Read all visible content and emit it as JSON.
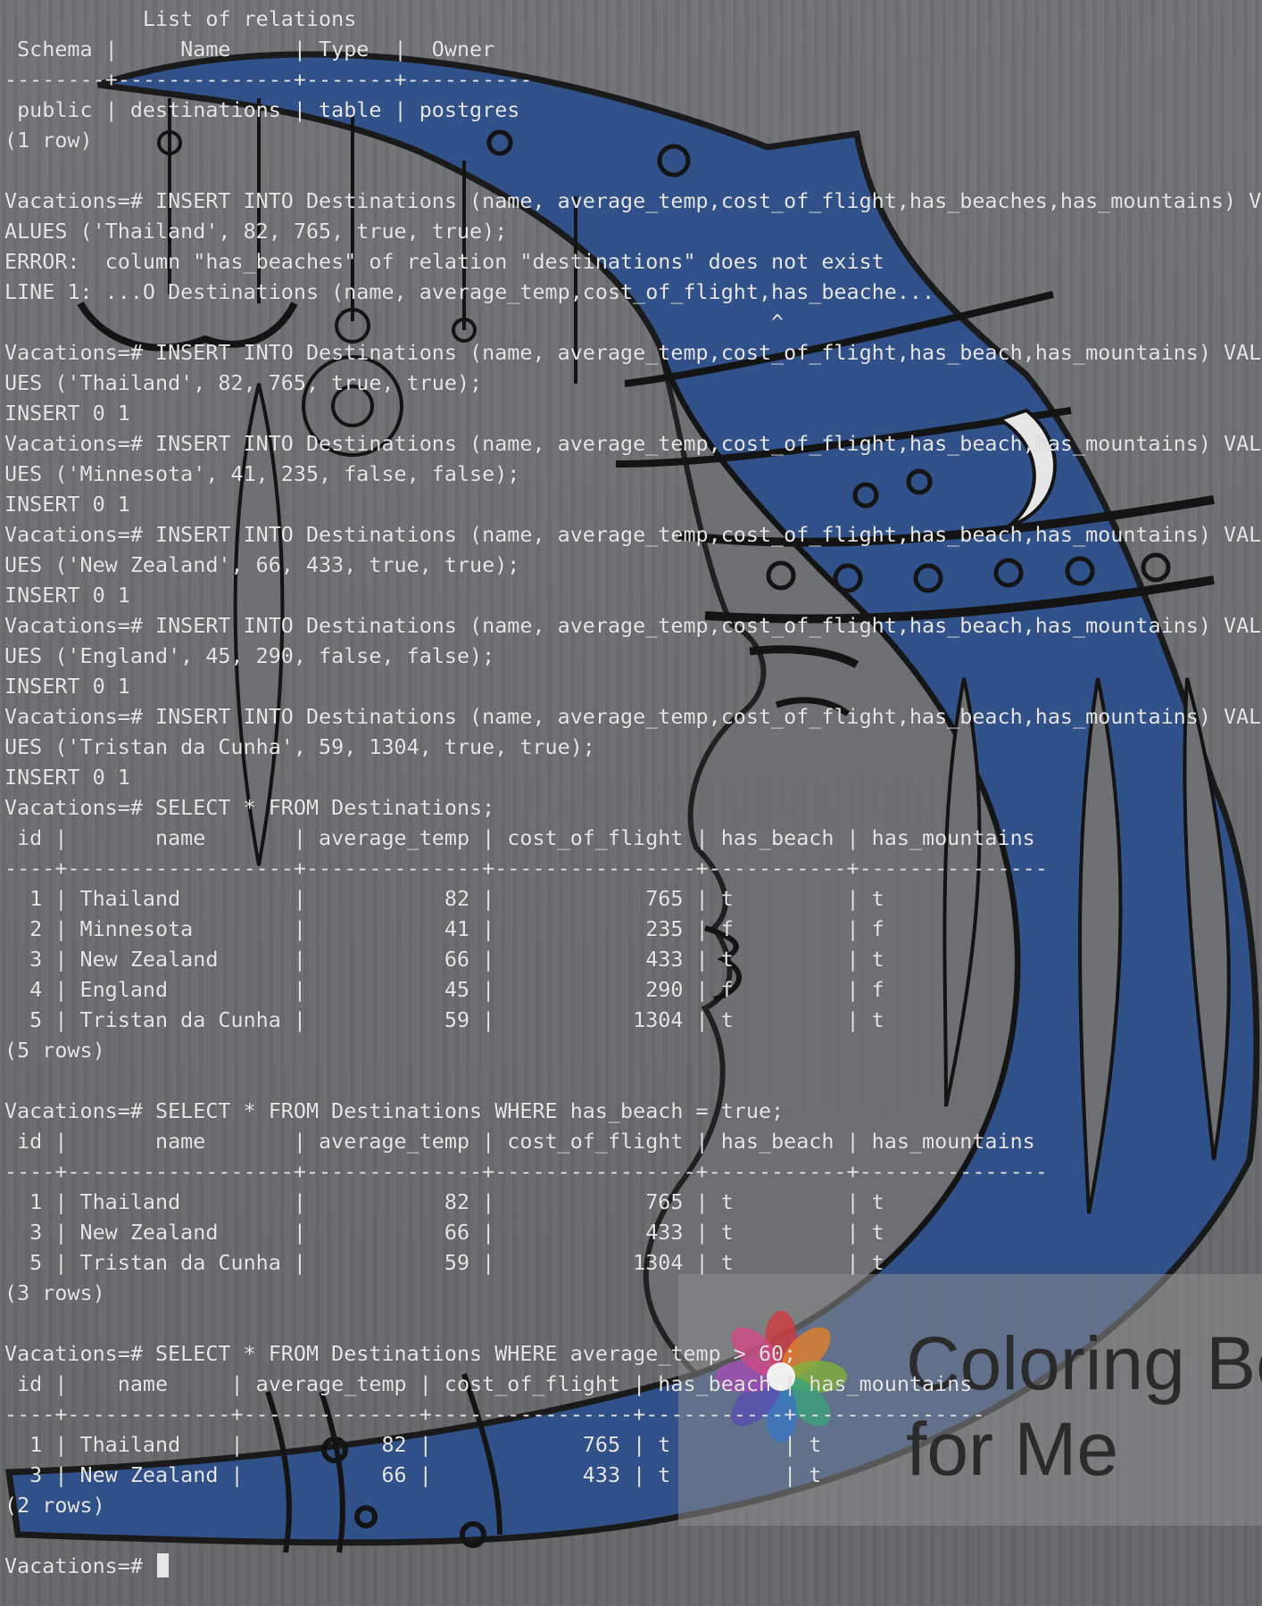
{
  "terminal": {
    "lines": [
      "           List of relations",
      " Schema |     Name     | Type  |  Owner",
      "--------+--------------+-------+----------",
      " public | destinations | table | postgres",
      "(1 row)",
      "",
      "Vacations=# INSERT INTO Destinations (name, average_temp,cost_of_flight,has_beaches,has_mountains) V",
      "ALUES ('Thailand', 82, 765, true, true);",
      "ERROR:  column \"has_beaches\" of relation \"destinations\" does not exist",
      "LINE 1: ...O Destinations (name, average_temp,cost_of_flight,has_beache...",
      "                                                             ^",
      "Vacations=# INSERT INTO Destinations (name, average_temp,cost_of_flight,has_beach,has_mountains) VAL",
      "UES ('Thailand', 82, 765, true, true);",
      "INSERT 0 1",
      "Vacations=# INSERT INTO Destinations (name, average_temp,cost_of_flight,has_beach,has_mountains) VAL",
      "UES ('Minnesota', 41, 235, false, false);",
      "INSERT 0 1",
      "Vacations=# INSERT INTO Destinations (name, average_temp,cost_of_flight,has_beach,has_mountains) VAL",
      "UES ('New Zealand', 66, 433, true, true);",
      "INSERT 0 1",
      "Vacations=# INSERT INTO Destinations (name, average_temp,cost_of_flight,has_beach,has_mountains) VAL",
      "UES ('England', 45, 290, false, false);",
      "INSERT 0 1",
      "Vacations=# INSERT INTO Destinations (name, average_temp,cost_of_flight,has_beach,has_mountains) VAL",
      "UES ('Tristan da Cunha', 59, 1304, true, true);",
      "INSERT 0 1",
      "Vacations=# SELECT * FROM Destinations;",
      " id |       name       | average_temp | cost_of_flight | has_beach | has_mountains",
      "----+------------------+--------------+----------------+-----------+---------------",
      "  1 | Thailand         |           82 |            765 | t         | t",
      "  2 | Minnesota        |           41 |            235 | f         | f",
      "  3 | New Zealand      |           66 |            433 | t         | t",
      "  4 | England          |           45 |            290 | f         | f",
      "  5 | Tristan da Cunha |           59 |           1304 | t         | t",
      "(5 rows)",
      "",
      "Vacations=# SELECT * FROM Destinations WHERE has_beach = true;",
      " id |       name       | average_temp | cost_of_flight | has_beach | has_mountains",
      "----+------------------+--------------+----------------+-----------+---------------",
      "  1 | Thailand         |           82 |            765 | t         | t",
      "  3 | New Zealand      |           66 |            433 | t         | t",
      "  5 | Tristan da Cunha |           59 |           1304 | t         | t",
      "(3 rows)",
      "",
      "Vacations=# SELECT * FROM Destinations WHERE average_temp > 60;",
      " id |    name     | average_temp | cost_of_flight | has_beach | has_mountains",
      "----+-------------+--------------+----------------+-----------+---------------",
      "  1 | Thailand    |           82 |            765 | t         | t",
      "  3 | New Zealand |           66 |            433 | t         | t",
      "(2 rows)",
      ""
    ],
    "prompt": "Vacations=# "
  },
  "watermark": {
    "line1": "Coloring Bo",
    "line2": "for Me"
  },
  "colors": {
    "background": "#6b6d70",
    "text": "#e6e6e6",
    "wallpaper_blue": "#2c4f8c",
    "wallpaper_ink": "#141414"
  }
}
